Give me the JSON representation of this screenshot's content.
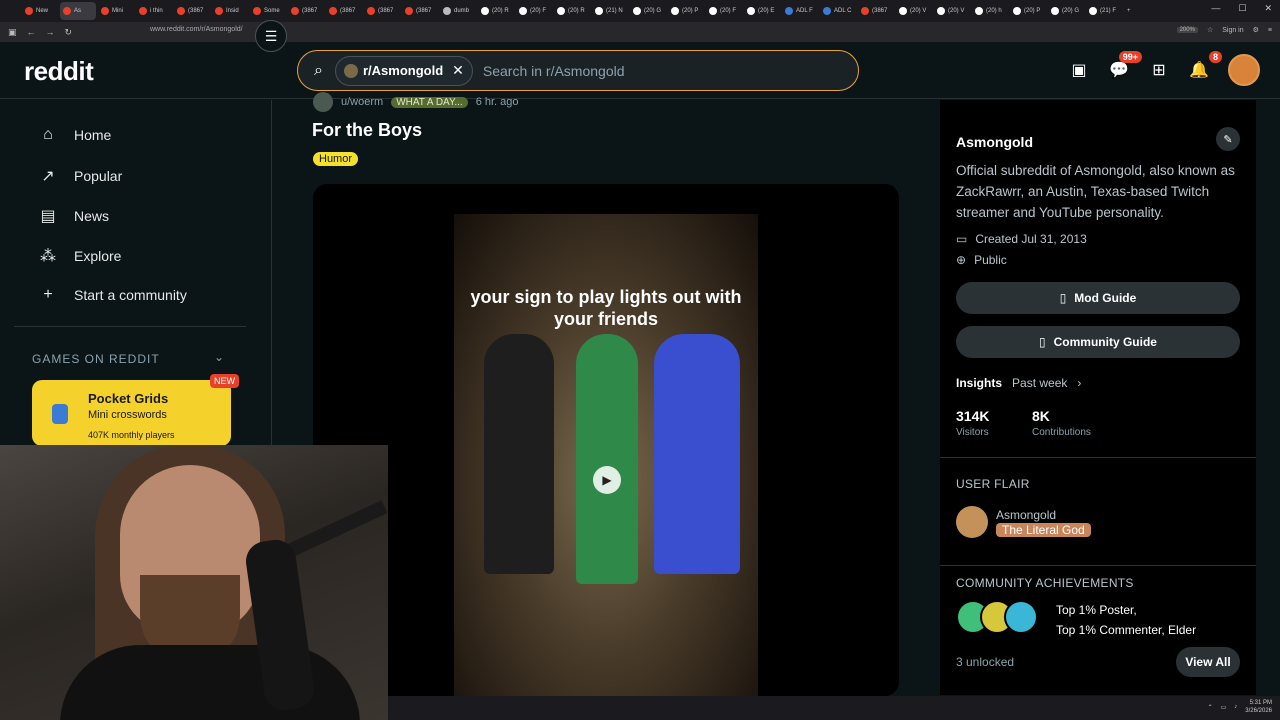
{
  "browser": {
    "tabs": [
      {
        "label": "New",
        "color": "#e8412a"
      },
      {
        "label": "As",
        "color": "#e8412a",
        "active": true
      },
      {
        "label": "Mini",
        "color": "#e8412a"
      },
      {
        "label": "i thin",
        "color": "#e8412a"
      },
      {
        "label": "(3867",
        "color": "#e8412a"
      },
      {
        "label": "Insid",
        "color": "#e8412a"
      },
      {
        "label": "Some",
        "color": "#e8412a"
      },
      {
        "label": "(3867",
        "color": "#e8412a"
      },
      {
        "label": "(3867",
        "color": "#e8412a"
      },
      {
        "label": "(3867",
        "color": "#e8412a"
      },
      {
        "label": "(3867",
        "color": "#e8412a"
      },
      {
        "label": "dumb",
        "color": "#bbbbbb"
      },
      {
        "label": "(20) R",
        "color": "#ffffff"
      },
      {
        "label": "(20) F",
        "color": "#ffffff"
      },
      {
        "label": "(20) R",
        "color": "#ffffff"
      },
      {
        "label": "(21) N",
        "color": "#ffffff"
      },
      {
        "label": "(20) G",
        "color": "#ffffff"
      },
      {
        "label": "(20) P",
        "color": "#ffffff"
      },
      {
        "label": "(20) F",
        "color": "#ffffff"
      },
      {
        "label": "(20) E",
        "color": "#ffffff"
      },
      {
        "label": "ADL F",
        "color": "#3b7bd6"
      },
      {
        "label": "ADL C",
        "color": "#3b7bd6"
      },
      {
        "label": "(3867",
        "color": "#e8412a"
      },
      {
        "label": "(20) V",
        "color": "#ffffff"
      },
      {
        "label": "(20) V",
        "color": "#ffffff"
      },
      {
        "label": "(20) h",
        "color": "#ffffff"
      },
      {
        "label": "(20) P",
        "color": "#ffffff"
      },
      {
        "label": "(20) G",
        "color": "#ffffff"
      },
      {
        "label": "(21) F",
        "color": "#ffffff"
      }
    ],
    "url": "www.reddit.com/r/Asmongold/",
    "zoom": "200%",
    "signin": "Sign in"
  },
  "header": {
    "logo": "reddit",
    "chip_label": "r/Asmongold",
    "search_placeholder": "Search in r/Asmongold",
    "chat_badge": "99+",
    "notif_badge": "8"
  },
  "sidebar": {
    "items": [
      {
        "label": "Home",
        "icon": "home-icon"
      },
      {
        "label": "Popular",
        "icon": "popular-icon"
      },
      {
        "label": "News",
        "icon": "news-icon"
      },
      {
        "label": "Explore",
        "icon": "explore-icon"
      },
      {
        "label": "Start a community",
        "icon": "plus-icon"
      }
    ],
    "games_header": "GAMES ON REDDIT",
    "game": {
      "title": "Pocket Grids",
      "subtitle": "Mini crosswords",
      "players": "407K monthly players",
      "tag": "NEW"
    }
  },
  "post": {
    "author": "u/woerm",
    "author_flair": "WHAT A DAY...",
    "time": "6 hr. ago",
    "title": "For the Boys",
    "flair": "Humor",
    "video_caption": "your sign to play lights out with your friends"
  },
  "community": {
    "name": "Asmongold",
    "description": "Official subreddit of Asmongold, also known as ZackRawrr, an Austin, Texas-based Twitch streamer and YouTube personality.",
    "created": "Created Jul 31, 2013",
    "visibility": "Public",
    "mod_guide": "Mod Guide",
    "community_guide": "Community Guide",
    "insights_label": "Insights",
    "insights_period": "Past week",
    "visitors_value": "314K",
    "visitors_label": "Visitors",
    "contrib_value": "8K",
    "contrib_label": "Contributions",
    "user_flair_header": "USER FLAIR",
    "flair_user": "Asmongold",
    "flair_text": "The Literal God",
    "achievements_header": "COMMUNITY ACHIEVEMENTS",
    "achievement_line1": "Top 1% Poster,",
    "achievement_line2": "Top 1% Commenter, Elder",
    "unlocked": "3 unlocked",
    "view_all": "View All"
  },
  "taskbar": {
    "time": "5:31 PM",
    "date": "3/26/2026"
  }
}
